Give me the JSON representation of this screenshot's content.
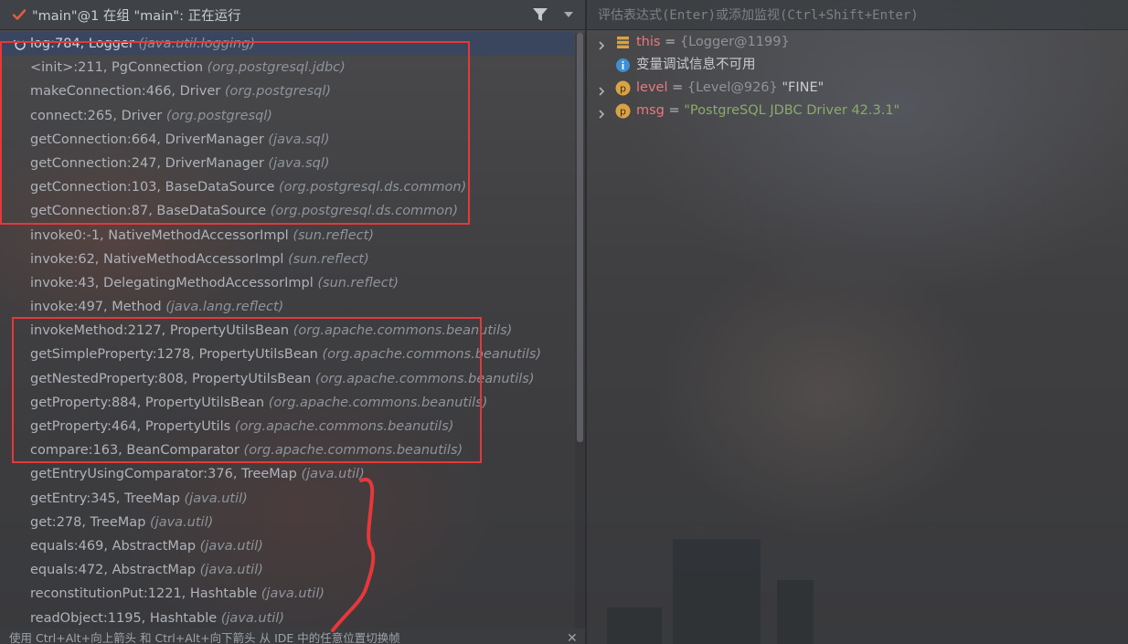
{
  "thread": {
    "title": "\"main\"@1 在组 \"main\": 正在运行",
    "filter_icon": "filter-icon",
    "status_icon": "check-icon",
    "status_color": "#e05d3f"
  },
  "frames": [
    {
      "method": "log:784, Logger",
      "pkg": "(java.util.logging)"
    },
    {
      "method": "<init>:211, PgConnection",
      "pkg": "(org.postgresql.jdbc)"
    },
    {
      "method": "makeConnection:466, Driver",
      "pkg": "(org.postgresql)"
    },
    {
      "method": "connect:265, Driver",
      "pkg": "(org.postgresql)"
    },
    {
      "method": "getConnection:664, DriverManager",
      "pkg": "(java.sql)"
    },
    {
      "method": "getConnection:247, DriverManager",
      "pkg": "(java.sql)"
    },
    {
      "method": "getConnection:103, BaseDataSource",
      "pkg": "(org.postgresql.ds.common)"
    },
    {
      "method": "getConnection:87, BaseDataSource",
      "pkg": "(org.postgresql.ds.common)"
    },
    {
      "method": "invoke0:-1, NativeMethodAccessorImpl",
      "pkg": "(sun.reflect)"
    },
    {
      "method": "invoke:62, NativeMethodAccessorImpl",
      "pkg": "(sun.reflect)"
    },
    {
      "method": "invoke:43, DelegatingMethodAccessorImpl",
      "pkg": "(sun.reflect)"
    },
    {
      "method": "invoke:497, Method",
      "pkg": "(java.lang.reflect)"
    },
    {
      "method": "invokeMethod:2127, PropertyUtilsBean",
      "pkg": "(org.apache.commons.beanutils)"
    },
    {
      "method": "getSimpleProperty:1278, PropertyUtilsBean",
      "pkg": "(org.apache.commons.beanutils)"
    },
    {
      "method": "getNestedProperty:808, PropertyUtilsBean",
      "pkg": "(org.apache.commons.beanutils)"
    },
    {
      "method": "getProperty:884, PropertyUtilsBean",
      "pkg": "(org.apache.commons.beanutils)"
    },
    {
      "method": "getProperty:464, PropertyUtils",
      "pkg": "(org.apache.commons.beanutils)"
    },
    {
      "method": "compare:163, BeanComparator",
      "pkg": "(org.apache.commons.beanutils)"
    },
    {
      "method": "getEntryUsingComparator:376, TreeMap",
      "pkg": "(java.util)"
    },
    {
      "method": "getEntry:345, TreeMap",
      "pkg": "(java.util)"
    },
    {
      "method": "get:278, TreeMap",
      "pkg": "(java.util)"
    },
    {
      "method": "equals:469, AbstractMap",
      "pkg": "(java.util)"
    },
    {
      "method": "equals:472, AbstractMap",
      "pkg": "(java.util)"
    },
    {
      "method": "reconstitutionPut:1221, Hashtable",
      "pkg": "(java.util)"
    },
    {
      "method": "readObject:1195, Hashtable",
      "pkg": "(java.util)"
    }
  ],
  "hint": {
    "text": "使用 Ctrl+Alt+向上箭头 和 Ctrl+Alt+向下箭头 从 IDE 中的任意位置切换帧",
    "close": "✕"
  },
  "eval": {
    "placeholder": "评估表达式(Enter)或添加监视(Ctrl+Shift+Enter)"
  },
  "variables": [
    {
      "name": "this",
      "eq": " = ",
      "ref": "{Logger@1199}",
      "value": "",
      "badge": "field-icon",
      "expandable": true
    },
    {
      "info": "变量调试信息不可用",
      "badge": "info-icon"
    },
    {
      "name": "level",
      "eq": " = ",
      "ref": "{Level@926}",
      "value": " \"FINE\"",
      "badge": "parameter-icon",
      "badge_letter": "p",
      "expandable": true
    },
    {
      "name": "msg",
      "eq": " = ",
      "ref": "",
      "str": "\"PostgreSQL JDBC Driver 42.3.1\"",
      "badge": "parameter-icon",
      "badge_letter": "p",
      "expandable": true
    }
  ],
  "colors": {
    "annotation_red": "#e5383b",
    "variable_name": "#e87a7f",
    "string_value": "#8cab6a",
    "param_badge": "#d9a343"
  }
}
